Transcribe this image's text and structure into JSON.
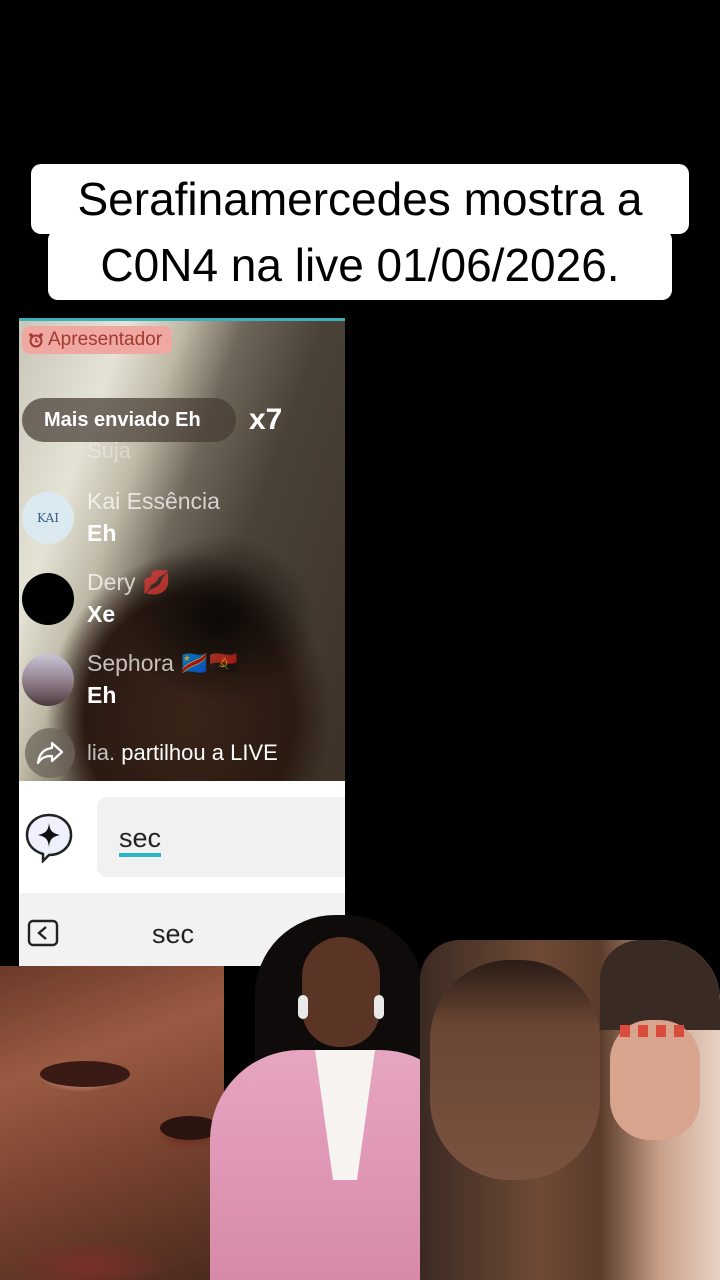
{
  "caption": {
    "line1": "Serafinamercedes mostra a",
    "line2": "C0N4 na live 01/06/2026."
  },
  "live": {
    "host_badge": "Apresentador",
    "gift_banner": "Mais enviado Eh",
    "gift_count": "x7",
    "ghost_name": "Suja",
    "comments": [
      {
        "user": "Kai Essência",
        "text": "Eh",
        "avatar_text": "KAI"
      },
      {
        "user": "Dery 💋",
        "text": "Xe"
      },
      {
        "user": "Sephora 🇨🇩🇦🇴",
        "text": "Eh"
      }
    ],
    "share": {
      "user": "lia.",
      "text": "partilhou a LIVE"
    }
  },
  "input": {
    "value": "sec",
    "suggestion": "sec"
  },
  "colors": {
    "accent": "#2bb5c9",
    "host_badge_bg": "#f0a8a2",
    "suit_pink": "#e6a6c0"
  },
  "icons": {
    "host": "alarm-clock-icon",
    "share": "share-arrow-icon",
    "sparkle": "sparkle-icon",
    "back": "back-arrow-icon"
  }
}
